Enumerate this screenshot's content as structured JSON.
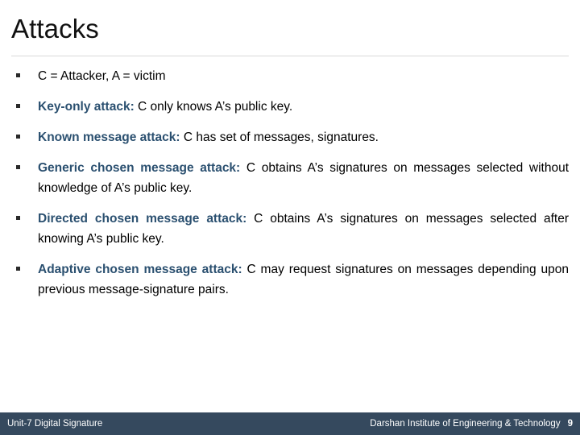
{
  "slide": {
    "title": "Attacks",
    "footer": {
      "left": "Unit-7  Digital Signature",
      "organization": "Darshan Institute of Engineering & Technology",
      "page_number": "9"
    },
    "colors": {
      "title_text": "#111111",
      "lead_label": "#2b5070",
      "body_text": "#000000",
      "rule": "#d9d9d9",
      "footer_bg": "#35495e",
      "footer_text": "#ffffff"
    },
    "bullets": [
      {
        "marker": "square-bullet",
        "lead": "",
        "text": "C = Attacker, A = victim"
      },
      {
        "marker": "square-bullet",
        "lead": "Key-only attack:",
        "text": " C only knows A’s public key."
      },
      {
        "marker": "square-bullet",
        "lead": "Known message attack:",
        "text": " C has set of messages, signatures."
      },
      {
        "marker": "square-bullet",
        "lead": "Generic chosen message attack:",
        "text": " C obtains A’s signatures on messages selected without knowledge of A’s public key."
      },
      {
        "marker": "square-bullet",
        "lead": "Directed chosen message attack:",
        "text": " C obtains A’s signatures on messages selected after knowing A’s public key."
      },
      {
        "marker": "square-bullet",
        "lead": "Adaptive chosen message attack:",
        "text": " C may request signatures on messages depending upon previous message-signature pairs."
      }
    ]
  }
}
